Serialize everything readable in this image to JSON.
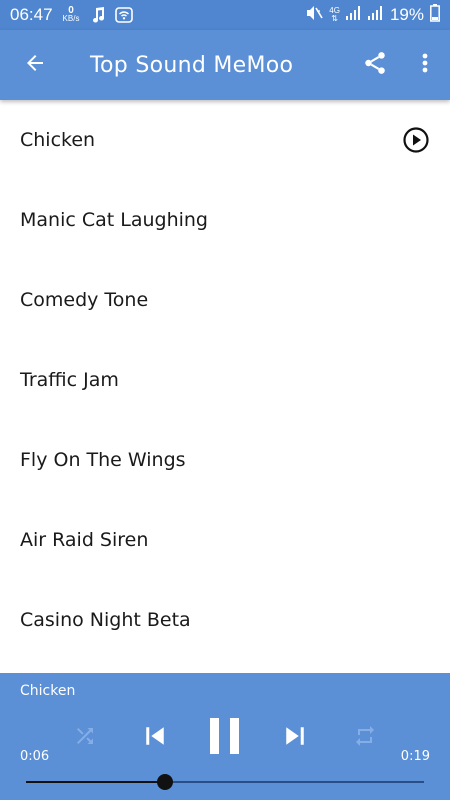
{
  "status_bar": {
    "time": "06:47",
    "net_speed_value": "0",
    "net_speed_unit": "KB/s",
    "network_label": "4G",
    "battery": "19%"
  },
  "app_bar": {
    "title": "Top Sound MeMoo",
    "back_icon": "arrow-left-icon",
    "share_icon": "share-icon",
    "menu_icon": "more-vert-icon"
  },
  "sounds": [
    {
      "label": "Chicken",
      "playing": true
    },
    {
      "label": "Manic Cat Laughing"
    },
    {
      "label": "Comedy Tone"
    },
    {
      "label": "Traffic Jam"
    },
    {
      "label": "Fly On The Wings"
    },
    {
      "label": "Air Raid Siren"
    },
    {
      "label": "Casino Night Beta"
    }
  ],
  "player": {
    "now_playing": "Chicken",
    "elapsed": "0:06",
    "total": "0:19",
    "progress": 0.35,
    "shuffle_enabled": false,
    "repeat_enabled": false
  },
  "colors": {
    "status_bar": "#4f86cf",
    "app_bar": "#5b8fd6",
    "player": "#5b8fd6"
  }
}
